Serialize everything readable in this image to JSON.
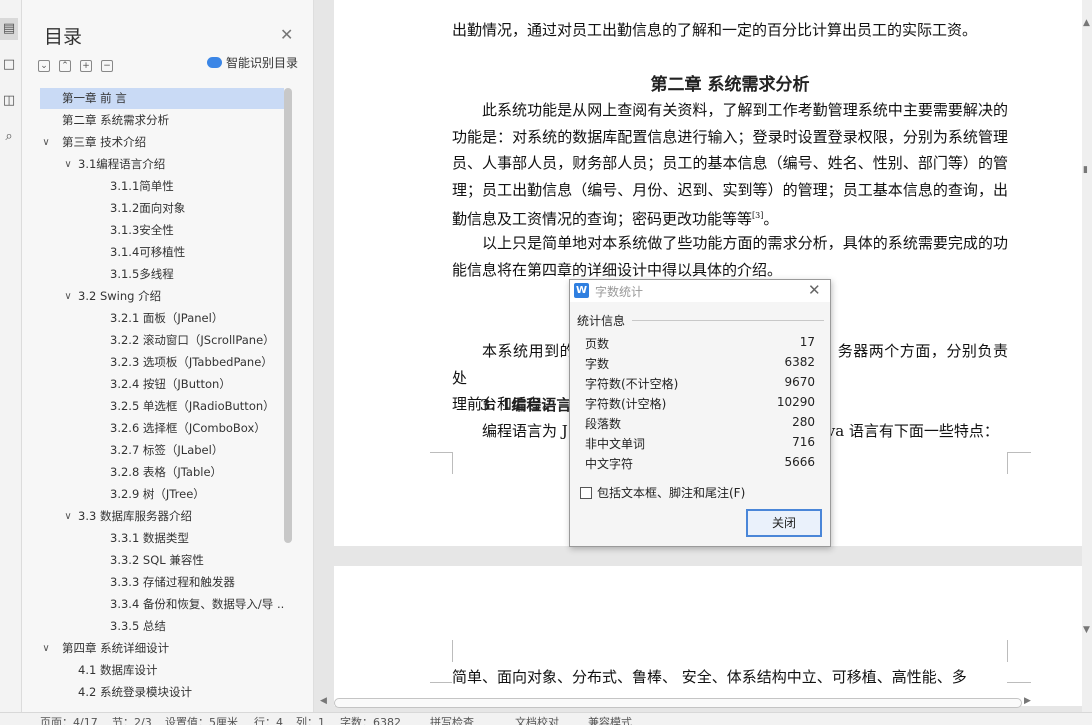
{
  "toc": {
    "title": "目录",
    "smart_toc_label": "智能识别目录",
    "items": [
      {
        "label": "第一章  前      言",
        "level": 0,
        "chevron": "",
        "selected": true
      },
      {
        "label": "第二章  系统需求分析",
        "level": 0,
        "chevron": ""
      },
      {
        "label": "第三章  技术介绍",
        "level": 0,
        "chevron": "∨"
      },
      {
        "label": "3.1编程语言介绍",
        "level": 1,
        "chevron": "∨"
      },
      {
        "label": "3.1.1简单性",
        "level": 2,
        "chevron": ""
      },
      {
        "label": "3.1.2面向对象",
        "level": 2,
        "chevron": ""
      },
      {
        "label": "3.1.3安全性",
        "level": 2,
        "chevron": ""
      },
      {
        "label": "3.1.4可移植性",
        "level": 2,
        "chevron": ""
      },
      {
        "label": "3.1.5多线程",
        "level": 2,
        "chevron": ""
      },
      {
        "label": "3.2 Swing 介绍",
        "level": 1,
        "chevron": "∨"
      },
      {
        "label": "3.2.1  面板（JPanel）",
        "level": 2,
        "chevron": ""
      },
      {
        "label": "3.2.2  滚动窗口（JScrollPane）",
        "level": 2,
        "chevron": ""
      },
      {
        "label": "3.2.3  选项板（JTabbedPane）",
        "level": 2,
        "chevron": ""
      },
      {
        "label": "3.2.4  按钮（JButton）",
        "level": 2,
        "chevron": ""
      },
      {
        "label": "3.2.5  单选框（JRadioButton）",
        "level": 2,
        "chevron": ""
      },
      {
        "label": "3.2.6  选择框（JComboBox）",
        "level": 2,
        "chevron": ""
      },
      {
        "label": "3.2.7  标签（JLabel）",
        "level": 2,
        "chevron": ""
      },
      {
        "label": "3.2.8  表格（JTable）",
        "level": 2,
        "chevron": ""
      },
      {
        "label": "3.2.9  树（JTree）",
        "level": 2,
        "chevron": ""
      },
      {
        "label": "3.3  数据库服务器介绍",
        "level": 1,
        "chevron": "∨"
      },
      {
        "label": "3.3.1  数据类型",
        "level": 2,
        "chevron": ""
      },
      {
        "label": "3.3.2 SQL 兼容性",
        "level": 2,
        "chevron": ""
      },
      {
        "label": "3.3.3  存储过程和触发器",
        "level": 2,
        "chevron": ""
      },
      {
        "label": "3.3.4  备份和恢复、数据导入/导 ...",
        "level": 2,
        "chevron": ""
      },
      {
        "label": "3.3.5  总结",
        "level": 2,
        "chevron": ""
      },
      {
        "label": "第四章  系统详细设计",
        "level": 0,
        "chevron": "∨"
      },
      {
        "label": "4.1  数据库设计",
        "level": 1,
        "chevron": ""
      },
      {
        "label": "4.2  系统登录模块设计",
        "level": 1,
        "chevron": ""
      }
    ]
  },
  "document": {
    "p_intro": "出勤情况，通过对员工出勤信息的了解和一定的百分比计算出员工的实际工资。",
    "chapter2_heading": "第二章  系统需求分析",
    "p1": "此系统功能是从网上查阅有关资料，了解到工作考勤管理系统中主要需要解决的功能是：对系统的数据库配置信息进行输入；登录时设置登录权限，分别为系统管理员、人事部人员，财务部人员；员工的基本信息（编号、姓名、性别、部门等）的管理；员工出勤信息（编号、月份、迟到、实到等）的管理；员工基本信息的查询，出勤信息及工资情况的查询；密码更改功能等等",
    "p1_ref": "[3]",
    "p1_end": "。",
    "p2": "以上只是简单地对本系统做了些功能方面的需求分析，具体的系统需要完成的功能信息将在第四章的详细设计中得以具体的介绍。",
    "p3_left": "本系统用到的",
    "p3_right": "务器两个方面，分别负责处",
    "p3_line2": "理前台和后台。",
    "h31": "3. 1编程语言",
    "p4_left": "编程语言为 J",
    "p4_right": "ava 语言有下面一些特点：",
    "page2_line": "简单、面向对象、分布式、鲁棒、 安全、体系结构中立、可移植、高性能、多"
  },
  "dialog": {
    "title": "字数统计",
    "group_label": "统计信息",
    "stats": [
      {
        "label": "页数",
        "value": "17"
      },
      {
        "label": "字数",
        "value": "6382"
      },
      {
        "label": "字符数(不计空格)",
        "value": "9670"
      },
      {
        "label": "字符数(计空格)",
        "value": "10290"
      },
      {
        "label": "段落数",
        "value": "280"
      },
      {
        "label": "非中文单词",
        "value": "716"
      },
      {
        "label": "中文字符",
        "value": "5666"
      }
    ],
    "checkbox_label": "包括文本框、脚注和尾注(F)",
    "close_button": "关闭"
  },
  "statusbar": {
    "page": "页面：4/17",
    "section": "节：2/3",
    "setting": "设置值：5厘米",
    "row": "行：4",
    "col": "列：1",
    "wordcount": "字数：6382",
    "spellcheck": "拼写检查",
    "proof": "文档校对",
    "compat": "兼容模式"
  },
  "colors": {
    "selected": "#c9daf5",
    "accent": "#2f7fe0"
  }
}
